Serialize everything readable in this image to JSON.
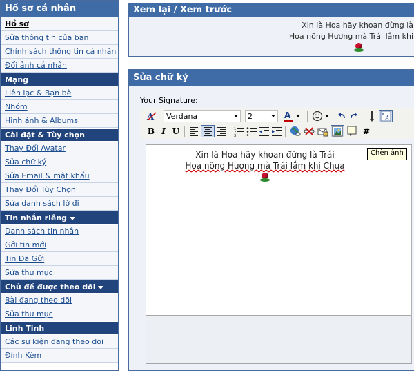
{
  "sidebar": {
    "title": "Hồ sơ cá nhân",
    "sections": [
      {
        "header": "",
        "items": [
          {
            "label": "Hồ sơ",
            "bold": true
          },
          {
            "label": "Sửa thông tin của bạn"
          },
          {
            "label": "Chính sách thông tin cá nhân"
          },
          {
            "label": "Đổi ảnh cá nhân"
          }
        ]
      },
      {
        "header": "Mạng",
        "items": [
          {
            "label": "Liên lạc & Bạn bè"
          },
          {
            "label": "Nhóm"
          },
          {
            "label": "Hình ảnh & Albums"
          }
        ]
      },
      {
        "header": "Cài đặt & Tùy chọn",
        "items": [
          {
            "label": "Thay Đổi Avatar"
          },
          {
            "label": "Sửa chữ ký"
          },
          {
            "label": "Sửa Email & mật khẩu"
          },
          {
            "label": "Thay Đổi Tùy Chọn"
          },
          {
            "label": "Sửa danh sách lờ đi"
          }
        ]
      },
      {
        "header": "Tin nhắn riêng",
        "collapsible": true,
        "items": [
          {
            "label": "Danh sách tin nhắn"
          },
          {
            "label": "Gởi tin mới"
          },
          {
            "label": "Tin Đã Gửi"
          },
          {
            "label": "Sửa thư mục"
          }
        ]
      },
      {
        "header": "Chủ đề được theo dõi",
        "collapsible": true,
        "items": [
          {
            "label": "Bài đang theo dõi"
          },
          {
            "label": "Sửa thư mục"
          }
        ]
      },
      {
        "header": "Linh Tinh",
        "items": [
          {
            "label": "Các sự kiện đang theo dõi"
          },
          {
            "label": "Đính Kèm"
          }
        ]
      }
    ]
  },
  "preview": {
    "title": "Xem lại / Xem trước",
    "line1": "Xin là Hoa hãy khoan đừng là",
    "line2": "Hoa nõng Hương mà Trái lắm khi"
  },
  "editor": {
    "title": "Sửa chữ ký",
    "signature_label": "Your Signature:",
    "font_value": "Verdana",
    "size_value": "2",
    "format": {
      "bold": "B",
      "italic": "I",
      "underline": "U"
    },
    "more_label": "#",
    "content_line1": "Xin là Hoa hãy khoan đừng là Trái",
    "content_line2": "Hoa nõng Hương mà Trái lắm khi Chua",
    "tooltip": "Chèn ảnh"
  },
  "colors": {
    "header_blue": "#3f6ba6",
    "section_navy": "#22447d",
    "link_blue": "#1a4c8f",
    "rose_red": "#c8102e"
  }
}
